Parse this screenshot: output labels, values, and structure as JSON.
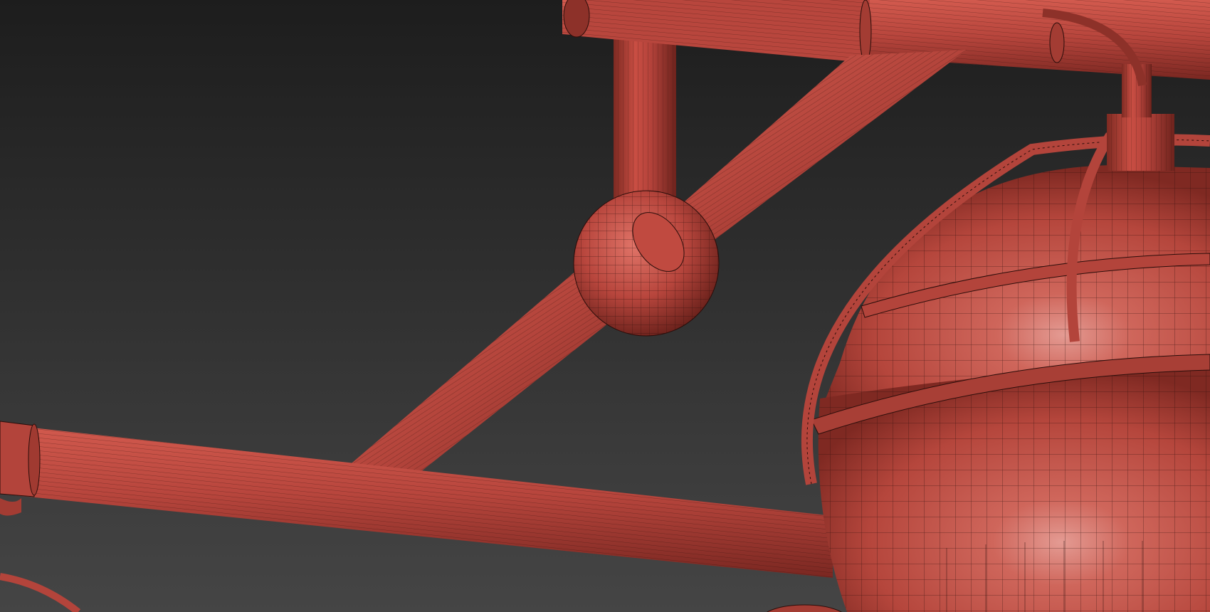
{
  "viewport": {
    "description_visible_text": "",
    "background_top": "#1d1d1d",
    "background_bottom": "#434343"
  },
  "model": {
    "material_color": "#c0473c",
    "material_shadow": "#7a2620",
    "material_highlight": "#e0766a",
    "wire_color": "#2a0d0a"
  }
}
